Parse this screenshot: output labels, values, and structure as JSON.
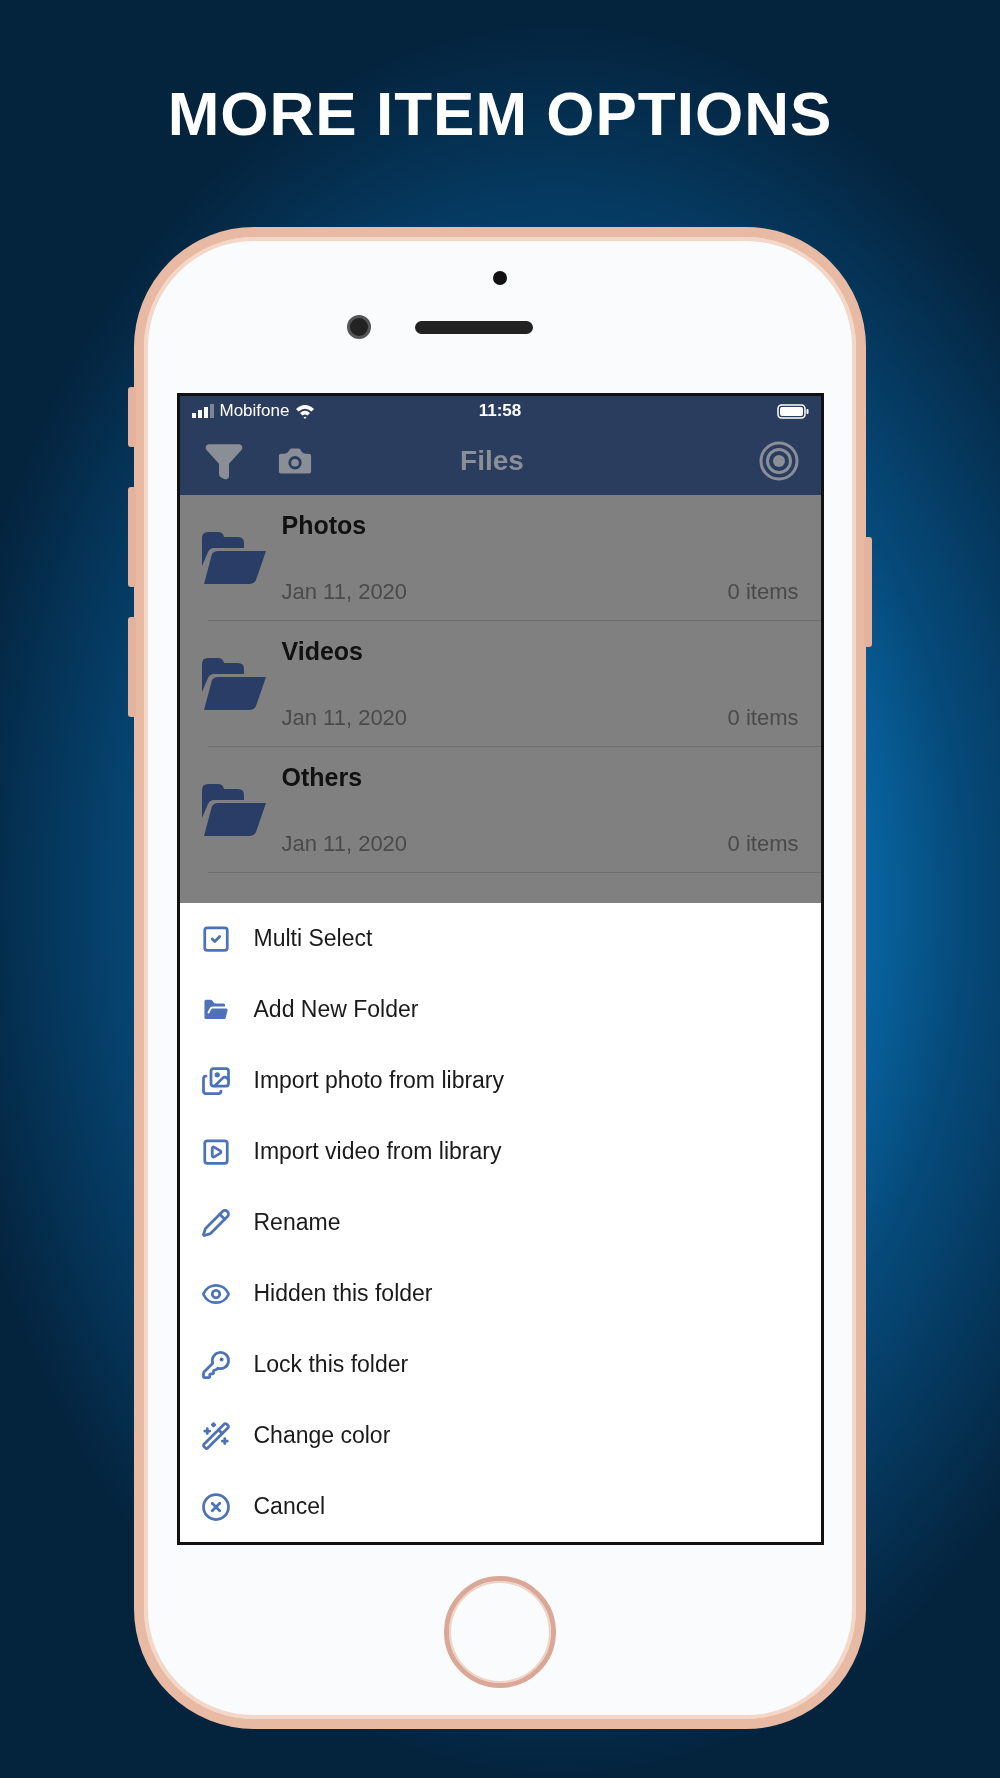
{
  "headline": "MORE ITEM OPTIONS",
  "status_bar": {
    "carrier": "Mobifone",
    "time": "11:58"
  },
  "nav_bar": {
    "title": "Files"
  },
  "folders": [
    {
      "name": "Photos",
      "date": "Jan 11, 2020",
      "count": "0 items"
    },
    {
      "name": "Videos",
      "date": "Jan 11, 2020",
      "count": "0 items"
    },
    {
      "name": "Others",
      "date": "Jan 11, 2020",
      "count": "0 items"
    }
  ],
  "action_sheet": {
    "items": [
      {
        "kind": "multi-select",
        "label": "Multi Select"
      },
      {
        "kind": "new-folder",
        "label": "Add New Folder"
      },
      {
        "kind": "import-photo",
        "label": "Import photo from library"
      },
      {
        "kind": "import-video",
        "label": "Import video from library"
      },
      {
        "kind": "rename",
        "label": "Rename"
      },
      {
        "kind": "hide",
        "label": "Hidden this folder"
      },
      {
        "kind": "lock",
        "label": "Lock this folder"
      },
      {
        "kind": "color",
        "label": "Change color"
      },
      {
        "kind": "cancel",
        "label": "Cancel"
      }
    ]
  }
}
